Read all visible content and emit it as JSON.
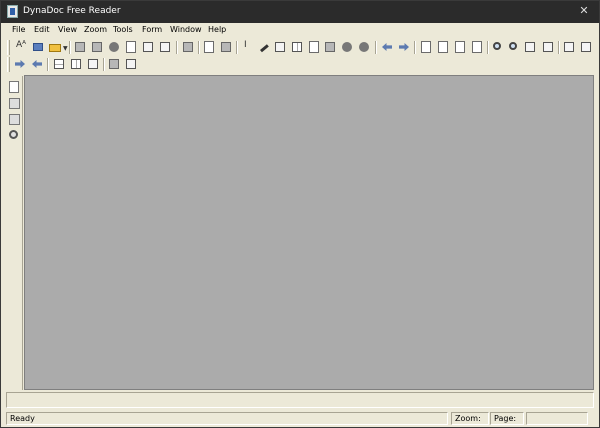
{
  "window": {
    "title": "DynaDoc Free Reader",
    "close_glyph": "✕"
  },
  "menu": {
    "items": [
      "File",
      "Edit",
      "View",
      "Zoom",
      "Tools",
      "Form",
      "Window",
      "Help"
    ]
  },
  "toolbar1": {
    "text_button_glyph": "Aᴬ",
    "cursor_glyph": "I",
    "dropdown_glyph": "▼"
  },
  "status": {
    "ready": "Ready",
    "zoom_label": "Zoom:",
    "page_label": "Page:"
  },
  "colors": {
    "titlebar": "#2b2b2b",
    "chrome": "#ece9d8",
    "workspace": "#ababab"
  }
}
